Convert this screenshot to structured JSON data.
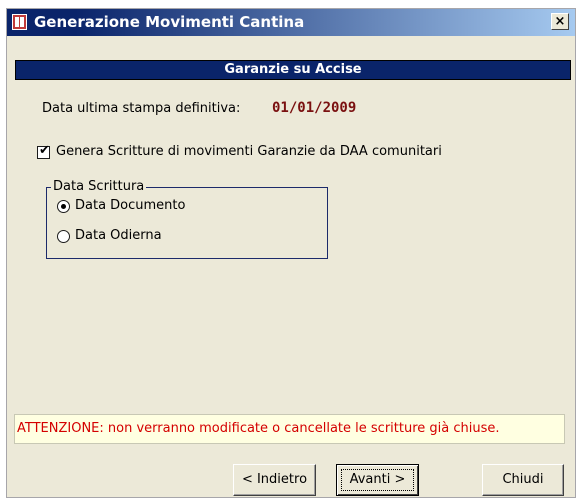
{
  "window": {
    "title": "Generazione Movimenti Cantina",
    "close_label": "×"
  },
  "section": {
    "title": "Garanzie su Accise"
  },
  "last_print": {
    "label": "Data ultima stampa definitiva:",
    "value": "01/01/2009"
  },
  "generate_option": {
    "label": "Genera Scritture di movimenti Garanzie da DAA comunitari",
    "checked": true
  },
  "date_group": {
    "title": "Data Scrittura",
    "options": [
      {
        "label": "Data Documento",
        "selected": true
      },
      {
        "label": "Data Odierna",
        "selected": false
      }
    ]
  },
  "warning": {
    "text": "ATTENZIONE: non verranno modificate o cancellate le scritture già chiuse.",
    "color": "#d40000"
  },
  "buttons": {
    "back": "< Indietro",
    "next": "Avanti >",
    "close": "Chiudi"
  },
  "colors": {
    "title_bar": "#0a246a",
    "section_header": "#0a246a",
    "date_value": "#7a1010",
    "dialog_bg": "#ece9d8",
    "warning_bg": "#ffffe1"
  }
}
